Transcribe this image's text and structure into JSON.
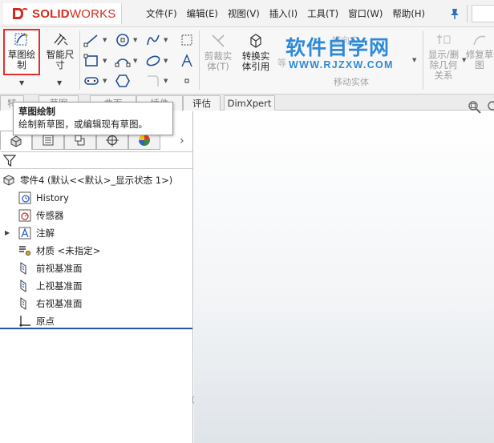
{
  "app": {
    "brand_prefix": "DS",
    "brand_solid": "SOLID",
    "brand_works": "WORKS"
  },
  "menu": {
    "file": "文件(F)",
    "edit": "编辑(E)",
    "view": "视图(V)",
    "insert": "插入(I)",
    "tools": "工具(T)",
    "window": "窗口(W)",
    "help": "帮助(H)"
  },
  "toolbar": {
    "sketch_line1": "草图绘",
    "sketch_line2": "制",
    "smart_dim_line1": "智能尺",
    "smart_dim_line2": "寸",
    "trim_line1": "剪裁实",
    "trim_line2": "体(T)",
    "convert_line1": "转换实",
    "convert_line2": "体引用",
    "ghost_offset": "等",
    "ghost_mirror": "镜向实",
    "move_entities": "移动实体",
    "display_delete_line1": "显示/删",
    "display_delete_line2": "除几何",
    "display_delete_line3": "关系",
    "repair_line1": "修复草",
    "repair_line2": "图"
  },
  "watermark": {
    "cn": "软件自学网",
    "url": "WWW.RJZXW.COM"
  },
  "tabs": {
    "tab1": "特",
    "tab2": "草图",
    "tab3": "曲面",
    "tab4": "插件",
    "evaluate": "评估",
    "dimxpert": "DimXpert"
  },
  "tooltip": {
    "title": "草图绘制",
    "description": "绘制新草图，或编辑现有草图。"
  },
  "tree": {
    "part": "零件4  (默认<<默认>_显示状态 1>)",
    "history": "History",
    "sensors": "传感器",
    "annotations": "注解",
    "material": "材质 <未指定>",
    "front_plane": "前视基准面",
    "top_plane": "上视基准面",
    "right_plane": "右视基准面",
    "origin": "原点"
  },
  "colors": {
    "brand_red": "#d52b1e",
    "highlight_red": "#e0302d",
    "watermark_blue": "#2d8ad8",
    "tree_end_blue": "#2554a8"
  }
}
